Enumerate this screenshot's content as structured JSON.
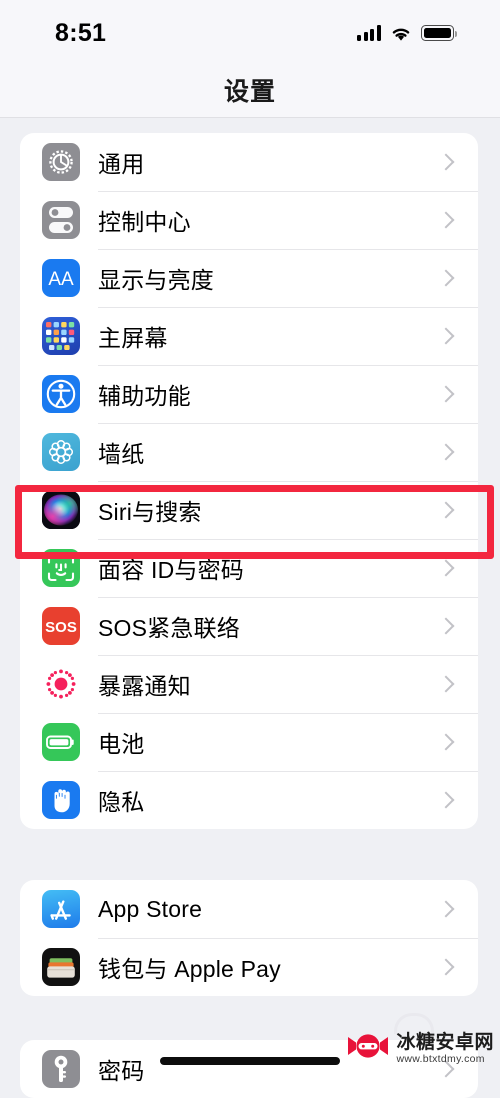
{
  "status_bar": {
    "time": "8:51",
    "signal_icon": "cellular-bars-icon",
    "wifi_icon": "wifi-icon",
    "battery_icon": "battery-full-icon"
  },
  "header": {
    "title": "设置"
  },
  "colors": {
    "page_background": "#eff0f4",
    "card_background": "#ffffff",
    "highlight_red": "#f3273f",
    "chevron_gray": "#c2c2c7",
    "separator": "#e6e6e9"
  },
  "sections": [
    {
      "id": "system-section",
      "rows": [
        {
          "label": "通用",
          "icon": "gear-icon",
          "highlighted": false
        },
        {
          "label": "控制中心",
          "icon": "control-center-icon",
          "highlighted": false
        },
        {
          "label": "显示与亮度",
          "icon": "display-brightness-icon",
          "highlighted": false
        },
        {
          "label": "主屏幕",
          "icon": "home-screen-icon",
          "highlighted": false
        },
        {
          "label": "辅助功能",
          "icon": "accessibility-icon",
          "highlighted": true
        },
        {
          "label": "墙纸",
          "icon": "wallpaper-icon",
          "highlighted": false
        },
        {
          "label": "Siri与搜索",
          "icon": "siri-icon",
          "highlighted": false
        },
        {
          "label": "面容 ID与密码",
          "icon": "face-id-icon",
          "highlighted": false
        },
        {
          "label": "SOS紧急联络",
          "icon": "emergency-sos-icon",
          "highlighted": false
        },
        {
          "label": "暴露通知",
          "icon": "exposure-notification-icon",
          "highlighted": false
        },
        {
          "label": "电池",
          "icon": "battery-icon",
          "highlighted": false
        },
        {
          "label": "隐私",
          "icon": "privacy-hand-icon",
          "highlighted": false
        }
      ]
    },
    {
      "id": "store-section",
      "rows": [
        {
          "label": "App Store",
          "icon": "app-store-icon",
          "highlighted": false
        },
        {
          "label": "钱包与 Apple Pay",
          "icon": "wallet-icon",
          "highlighted": false
        }
      ]
    },
    {
      "id": "passwords-section",
      "rows": [
        {
          "label": "密码",
          "icon": "passwords-key-icon",
          "highlighted": false
        }
      ]
    }
  ],
  "watermark": {
    "title": "冰糖安卓网",
    "url": "www.btxtdmy.com",
    "logo_icon": "candy-ninja-logo-icon"
  },
  "home_indicator": "home-indicator-bar"
}
